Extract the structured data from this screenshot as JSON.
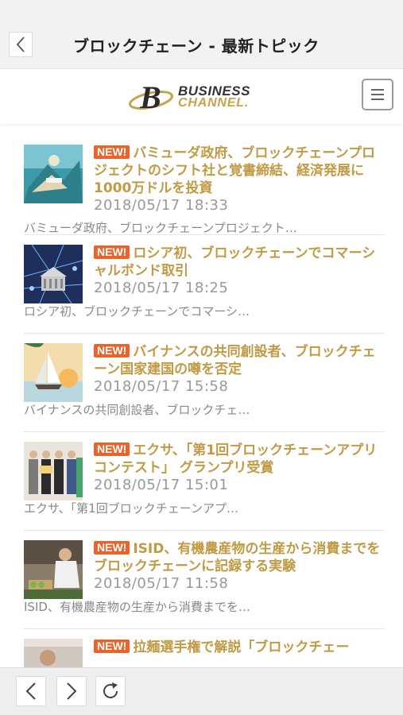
{
  "topbar": {
    "title": "ブロックチェーン - 最新トピック",
    "back_icon": "chevron-left-icon"
  },
  "header": {
    "logo_line1": "BUSINESS",
    "logo_line2": "CHANNEL.",
    "logo_mark": "B",
    "menu_icon": "hamburger-menu-icon"
  },
  "colors": {
    "accent_gold": "#c19a44",
    "badge_orange": "#e8642a",
    "meta_gray": "#999999"
  },
  "articles": [
    {
      "badge": "NEW!",
      "title": "バミューダ政府、ブロックチェーンプロジェクトのシフト社と覚書締結、経済発展に1000万ドルを投資",
      "date": "2018/05/17 18:33",
      "excerpt": "バミューダ政府、ブロックチェーンプロジェクト…"
    },
    {
      "badge": "NEW!",
      "title": "ロシア初、ブロックチェーンでコマーシャルボンド取引",
      "date": "2018/05/17 18:25",
      "excerpt": "ロシア初、ブロックチェーンでコマーシ…"
    },
    {
      "badge": "NEW!",
      "title": "バイナンスの共同創設者、ブロックチェーン国家建国の噂を否定",
      "date": "2018/05/17 15:58",
      "excerpt": "バイナンスの共同創設者、ブロックチェ…"
    },
    {
      "badge": "NEW!",
      "title": "エクサ、「第1回ブロックチェーンアプリコンテスト」 グランプリ受賞",
      "date": "2018/05/17 15:01",
      "excerpt": "エクサ、「第1回ブロックチェーンアプ…"
    },
    {
      "badge": "NEW!",
      "title": "ISID、有機農産物の生産から消費までをブロックチェーンに記録する実験",
      "date": "2018/05/17 11:58",
      "excerpt": "ISID、有機農産物の生産から消費までを…"
    },
    {
      "badge": "NEW!",
      "title": "拉麺選手権で解説「ブロックチェー"
    }
  ],
  "bottombar": {
    "back_icon": "arrow-left-icon",
    "forward_icon": "arrow-right-icon",
    "reload_icon": "reload-icon"
  }
}
